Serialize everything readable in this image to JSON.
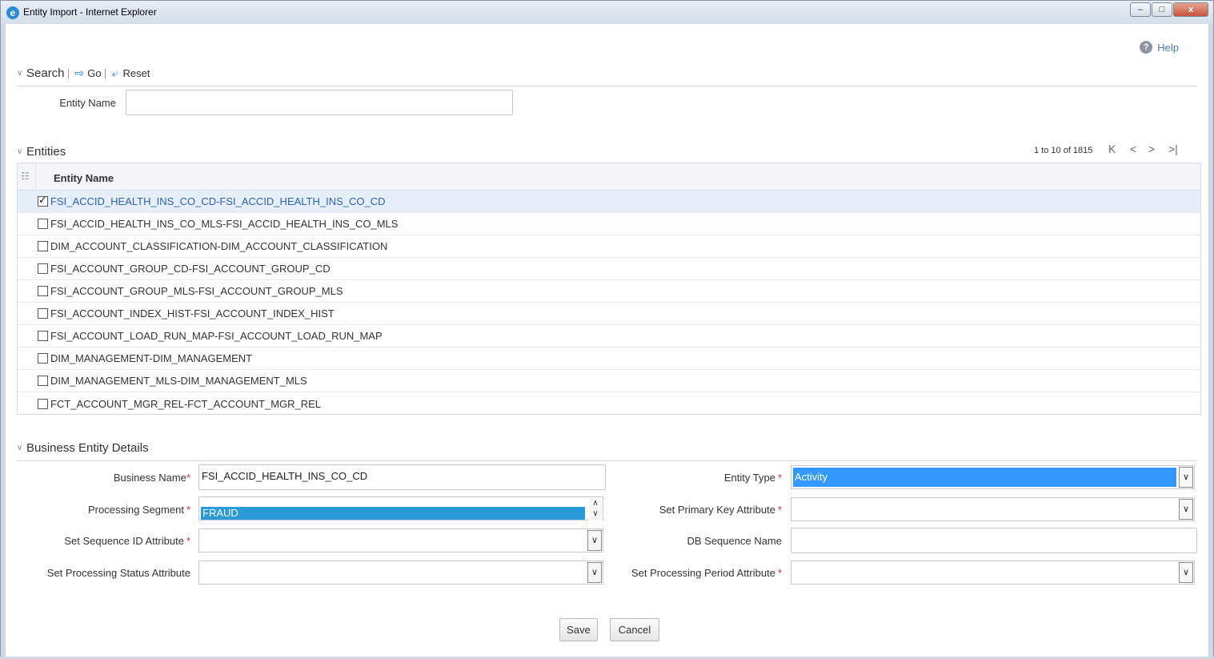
{
  "window": {
    "title": "Entity Import - Internet Explorer",
    "icon": "ie-icon",
    "min": "–",
    "max": "□",
    "close": "x"
  },
  "help": {
    "label": "Help",
    "icon": "?"
  },
  "search": {
    "section_label": "Search",
    "go_label": "Go",
    "reset_label": "Reset",
    "entity_name_label": "Entity Name",
    "entity_name_value": ""
  },
  "entities": {
    "section_label": "Entities",
    "pager_text": "1 to 10 of 1815",
    "pager_first": "K",
    "pager_prev": "<",
    "pager_next": ">",
    "pager_last": ">|",
    "column_header": "Entity Name",
    "rows": [
      {
        "label": "FSI_ACCID_HEALTH_INS_CO_CD-FSI_ACCID_HEALTH_INS_CO_CD",
        "checked": true
      },
      {
        "label": "FSI_ACCID_HEALTH_INS_CO_MLS-FSI_ACCID_HEALTH_INS_CO_MLS",
        "checked": false
      },
      {
        "label": "DIM_ACCOUNT_CLASSIFICATION-DIM_ACCOUNT_CLASSIFICATION",
        "checked": false
      },
      {
        "label": "FSI_ACCOUNT_GROUP_CD-FSI_ACCOUNT_GROUP_CD",
        "checked": false
      },
      {
        "label": "FSI_ACCOUNT_GROUP_MLS-FSI_ACCOUNT_GROUP_MLS",
        "checked": false
      },
      {
        "label": "FSI_ACCOUNT_INDEX_HIST-FSI_ACCOUNT_INDEX_HIST",
        "checked": false
      },
      {
        "label": "FSI_ACCOUNT_LOAD_RUN_MAP-FSI_ACCOUNT_LOAD_RUN_MAP",
        "checked": false
      },
      {
        "label": "DIM_MANAGEMENT-DIM_MANAGEMENT",
        "checked": false
      },
      {
        "label": "DIM_MANAGEMENT_MLS-DIM_MANAGEMENT_MLS",
        "checked": false
      },
      {
        "label": "FCT_ACCOUNT_MGR_REL-FCT_ACCOUNT_MGR_REL",
        "checked": false
      }
    ]
  },
  "details": {
    "section_label": "Business Entity Details",
    "business_name_label": "Business Name",
    "business_name_value": "FSI_ACCID_HEALTH_INS_CO_CD",
    "entity_type_label": "Entity Type",
    "entity_type_value": "Activity",
    "processing_segment_label": "Processing Segment",
    "processing_segment_value": "FRAUD",
    "primary_key_label": "Set Primary Key Attribute",
    "primary_key_value": "",
    "sequence_id_label": "Set Sequence ID Attribute",
    "sequence_id_value": "",
    "db_sequence_label": "DB Sequence Name",
    "db_sequence_value": "",
    "processing_status_label": "Set Processing Status Attribute",
    "processing_status_value": "",
    "processing_period_label": "Set Processing Period Attribute",
    "processing_period_value": "",
    "required_mark": "*"
  },
  "actions": {
    "save_label": "Save",
    "cancel_label": "Cancel"
  },
  "colors": {
    "accent": "#3399ff",
    "link": "#4a79b5",
    "required": "#d2322d"
  }
}
